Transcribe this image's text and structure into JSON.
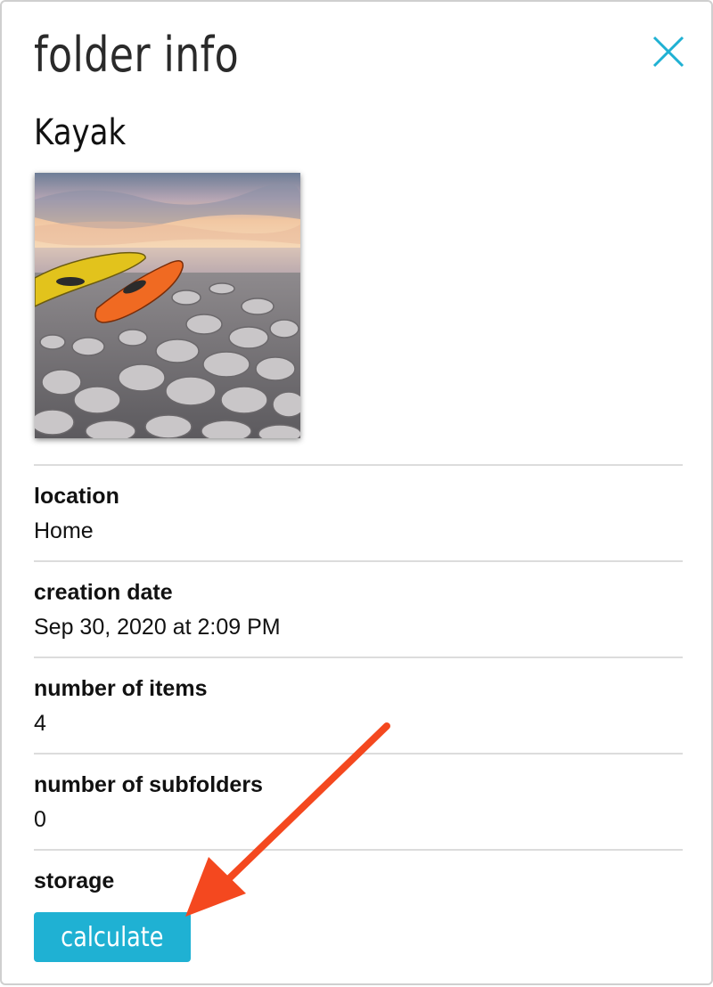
{
  "dialog": {
    "title": "folder info",
    "close_icon": "close-icon",
    "folder_name": "Kayak",
    "thumbnail_icon": "kayak-photo-thumbnail"
  },
  "fields": {
    "location": {
      "label": "location",
      "value": "Home"
    },
    "creation_date": {
      "label": "creation date",
      "value": "Sep 30, 2020 at 2:09 PM"
    },
    "items": {
      "label": "number of items",
      "value": "4"
    },
    "subfolders": {
      "label": "number of subfolders",
      "value": "0"
    },
    "storage": {
      "label": "storage",
      "button_label": "calculate"
    }
  },
  "colors": {
    "accent": "#1fb1d3",
    "annotation_arrow": "#f4481f",
    "divider": "#dcdcdc"
  }
}
